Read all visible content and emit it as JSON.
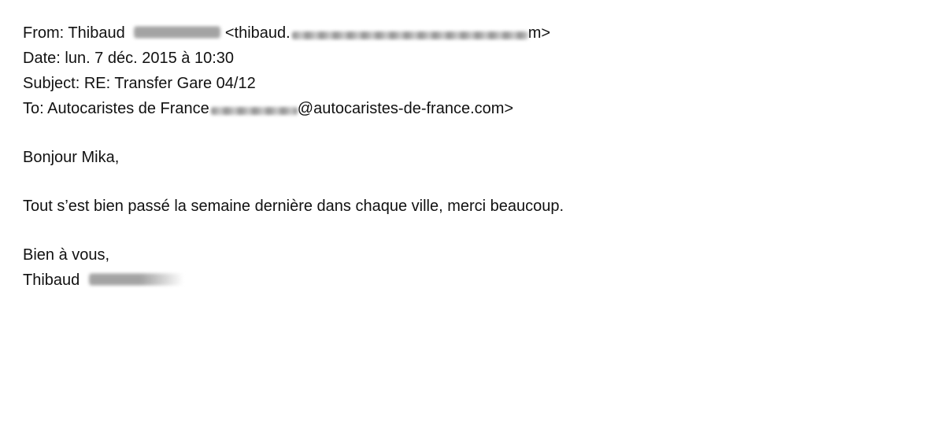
{
  "email": {
    "header": {
      "from_label": "From:",
      "from_name": "Thibaud",
      "from_email_open": "<thibaud.",
      "from_email_close": "m>",
      "date_label": "Date:",
      "date_value": "lun. 7 déc. 2015 à 10:30",
      "subject_label": "Subject:",
      "subject_value": "RE: Transfer Gare 04/12",
      "to_label": "To:",
      "to_name": "Autocaristes de France",
      "to_email_domain": "@autocaristes-de-france.com>"
    },
    "body": {
      "greeting": "Bonjour Mika,",
      "message": "Tout s’est bien passé la semaine dernière dans chaque ville, merci beaucoup.",
      "closing": "Bien à vous,",
      "signature_name": "Thibaud"
    }
  }
}
